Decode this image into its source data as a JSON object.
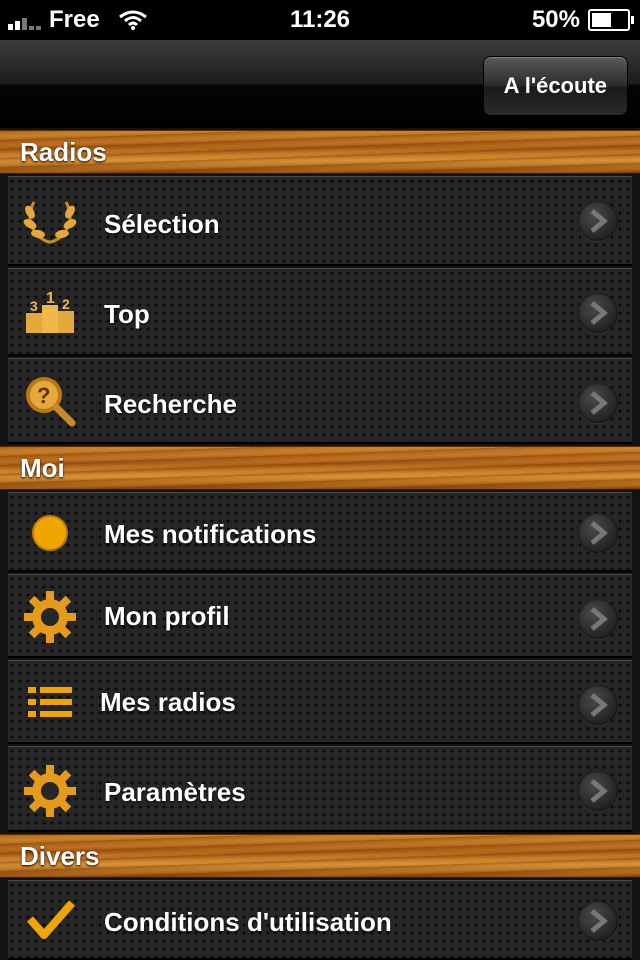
{
  "status_bar": {
    "carrier": "Free",
    "time": "11:26",
    "battery": "50%",
    "battery_level": 0.5
  },
  "nav": {
    "now_playing_label": "A l'écoute"
  },
  "sections": [
    {
      "title": "Radios"
    },
    {
      "title": "Moi"
    },
    {
      "title": "Divers"
    }
  ],
  "rows": {
    "selection": {
      "label": "Sélection",
      "icon": "laurel-icon"
    },
    "top": {
      "label": "Top",
      "icon": "podium-icon"
    },
    "recherche": {
      "label": "Recherche",
      "icon": "search-icon"
    },
    "notifications": {
      "label": "Mes notifications",
      "icon": "circle-icon"
    },
    "profil": {
      "label": "Mon profil",
      "icon": "gear-icon"
    },
    "mes_radios": {
      "label": "Mes radios",
      "icon": "list-icon"
    },
    "parametres": {
      "label": "Paramètres",
      "icon": "gear-icon"
    },
    "conditions": {
      "label": "Conditions d'utilisation",
      "icon": "checkmark-icon"
    }
  },
  "colors": {
    "accent": "#f0a500",
    "wood": "#b8661a"
  }
}
